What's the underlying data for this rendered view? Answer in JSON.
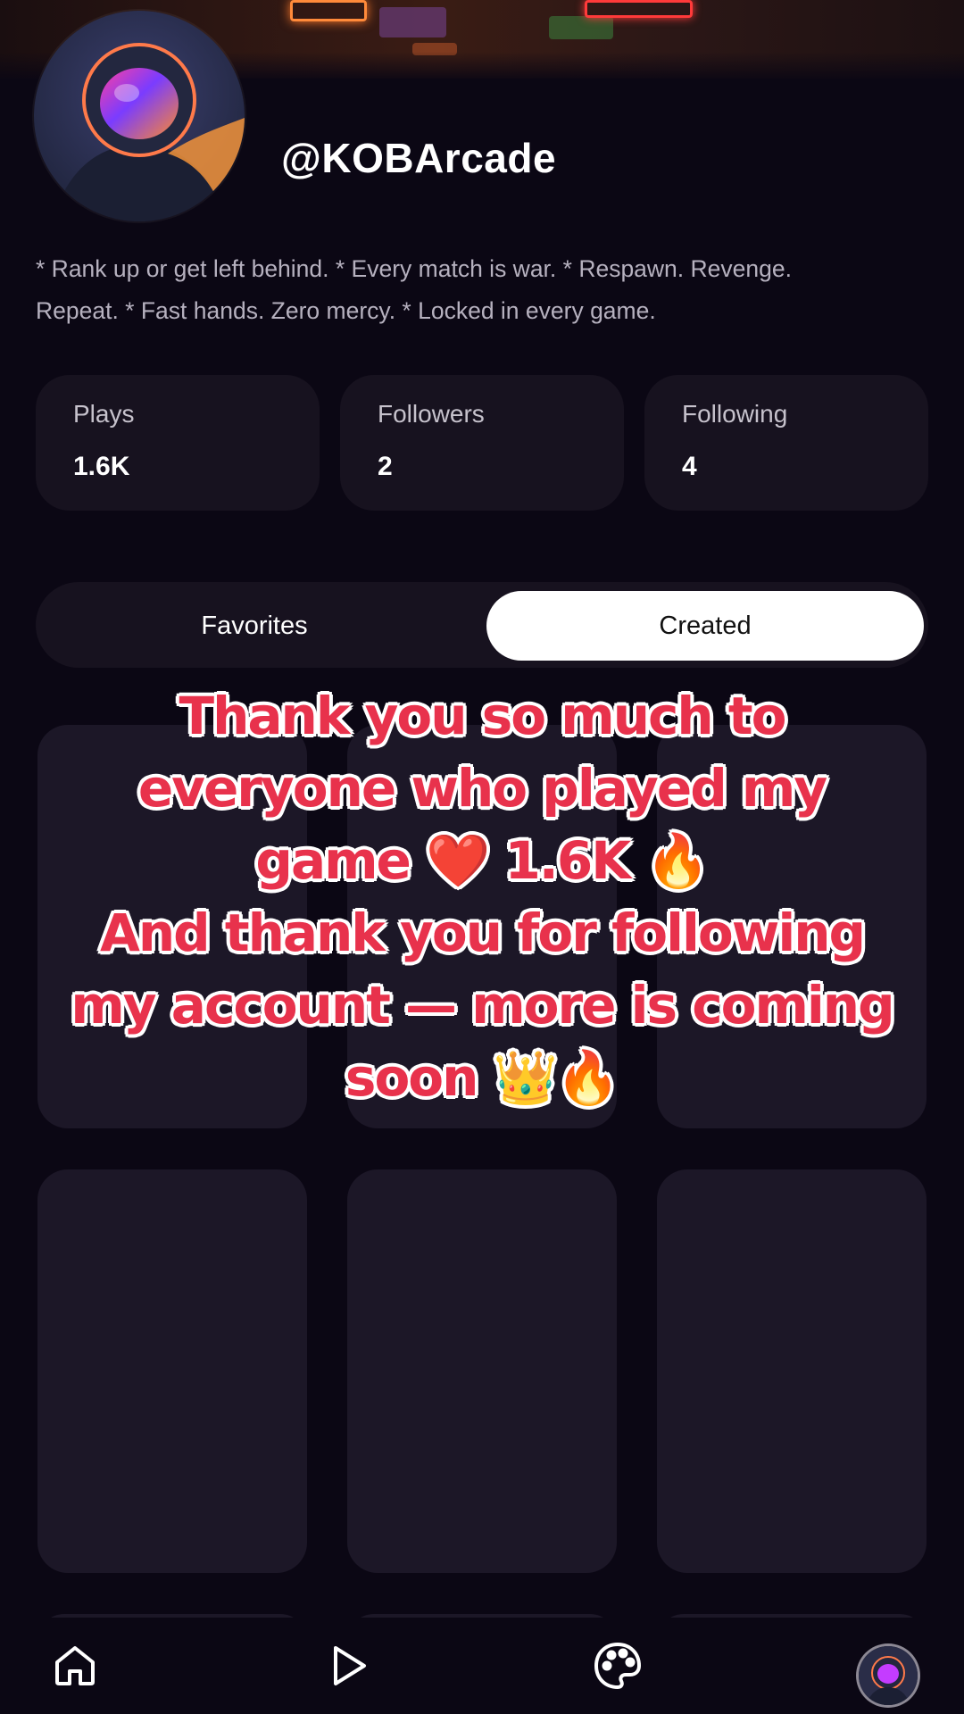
{
  "profile": {
    "username": "@KOBArcade",
    "bio_line1": "* Rank up or get left behind. * Every match is war. * Respawn. Revenge.",
    "bio_line2": "Repeat. * Fast hands. Zero mercy. * Locked in every game."
  },
  "stats": [
    {
      "label": "Plays",
      "value": "1.6K"
    },
    {
      "label": "Followers",
      "value": "2"
    },
    {
      "label": "Following",
      "value": "4"
    }
  ],
  "tabs": {
    "favorites": "Favorites",
    "created": "Created",
    "selected": "Created"
  },
  "overlay_caption": {
    "line1": "Thank you so much to",
    "line2": "everyone who played my",
    "line3": "game ❤️  1.6K 🔥",
    "line4": "And thank you for following",
    "line5": "my account — more is coming",
    "line6": "soon 👑🔥"
  },
  "bottom_nav": {
    "items": [
      "home-icon",
      "play-icon",
      "palette-icon",
      "profile-avatar"
    ]
  },
  "colors": {
    "background": "#0b0714",
    "card": "#1c1727",
    "caption_red": "#e8324c",
    "active_tab": "#ffffff"
  }
}
